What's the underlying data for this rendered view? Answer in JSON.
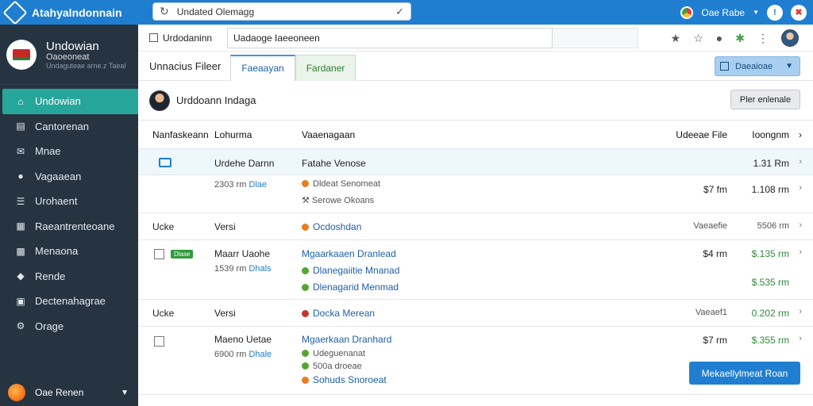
{
  "topbar": {
    "app_name": "Atahyalndonnain",
    "url_text": "Undated Olemagg",
    "account_label": "Oae Rabe"
  },
  "sidebar": {
    "profile": {
      "name": "Undowian",
      "sub": "Oaoeoneat",
      "sub2": "Undaguteae arne.z Taeal"
    },
    "items": [
      {
        "label": "Undowian",
        "icon": "home-icon",
        "active": true
      },
      {
        "label": "Cantorenan",
        "icon": "monitor-icon"
      },
      {
        "label": "Mnae",
        "icon": "mail-icon"
      },
      {
        "label": "Vagaaean",
        "icon": "user-icon"
      },
      {
        "label": "Urohaent",
        "icon": "list-icon"
      },
      {
        "label": "Raeantrenteoane",
        "icon": "grid-icon"
      },
      {
        "label": "Menaona",
        "icon": "calendar-icon"
      },
      {
        "label": "Rende",
        "icon": "tag-icon"
      },
      {
        "label": "Dectenahagrae",
        "icon": "document-icon"
      },
      {
        "label": "Orage",
        "icon": "gear-icon"
      }
    ],
    "footer": {
      "label": "Oae Renen"
    }
  },
  "header": {
    "project_name": "Urdodaninn",
    "path_value": "Uadaoge Iaeeoneen",
    "tabs_label": "Unnacius Fileer",
    "tabs": [
      {
        "label": "Faeaayan"
      },
      {
        "label": "Fardaner"
      }
    ],
    "action_label": "Daeaioae"
  },
  "user_row": {
    "name": "Urddoann Indaga",
    "button_label": "Pler enlenale"
  },
  "table": {
    "headers": {
      "a": "Nanfaskeann",
      "b": "Lohurma",
      "c": "Vaaenagaan",
      "d": "Udeeae File",
      "e": "Ioongnm"
    },
    "rows": [
      {
        "b": "Urdehe Darnn",
        "c": "Fatahe Venose",
        "e": "1.31 Rm"
      },
      {
        "b": "2303 rm",
        "b_link": "Dlae",
        "c_items": [
          "Dldeat Senomeat",
          "Serowe Okoans"
        ],
        "d": "$7 fm",
        "e": "1.108 rm"
      },
      {
        "a": "Ucke",
        "b": "Versi",
        "c": "Ocdoshdan",
        "d": "Vaeaefie",
        "e": "5506 rm"
      },
      {
        "badge": "Dlase",
        "b": "Maarr Uaohe",
        "b_sub": "1539 rm",
        "b_link": "Dhals",
        "c": "Mgaarkaaen Dranlead",
        "c_items": [
          "Dlanegaiitie Mnanad",
          "Dlenagarid Menmad"
        ],
        "d": "$4 rm",
        "e": "$.135 rm",
        "e2": "$.535 rm"
      },
      {
        "a": "Ucke",
        "b": "Versi",
        "c": "Docka Merean",
        "d": "Vaeaef1",
        "e": "0.202 rm"
      },
      {
        "b": "Maeno Uetae",
        "b_sub": "6900 rm",
        "b_link": "Dhale",
        "c": "Mgaerkaan Dranhard",
        "c_items": [
          "Udeguenanat",
          "500a droeae",
          "Sohuds Snoroeat"
        ],
        "d": "$7 rm",
        "e": "$.355 rm",
        "button": "Mekaellylmeat Roan"
      }
    ]
  },
  "colors": {
    "topbar": "#1f7ed0",
    "sidebar": "#263442",
    "active": "#26a69a",
    "primary": "#1f7ed0",
    "green": "#2e8b3a"
  }
}
